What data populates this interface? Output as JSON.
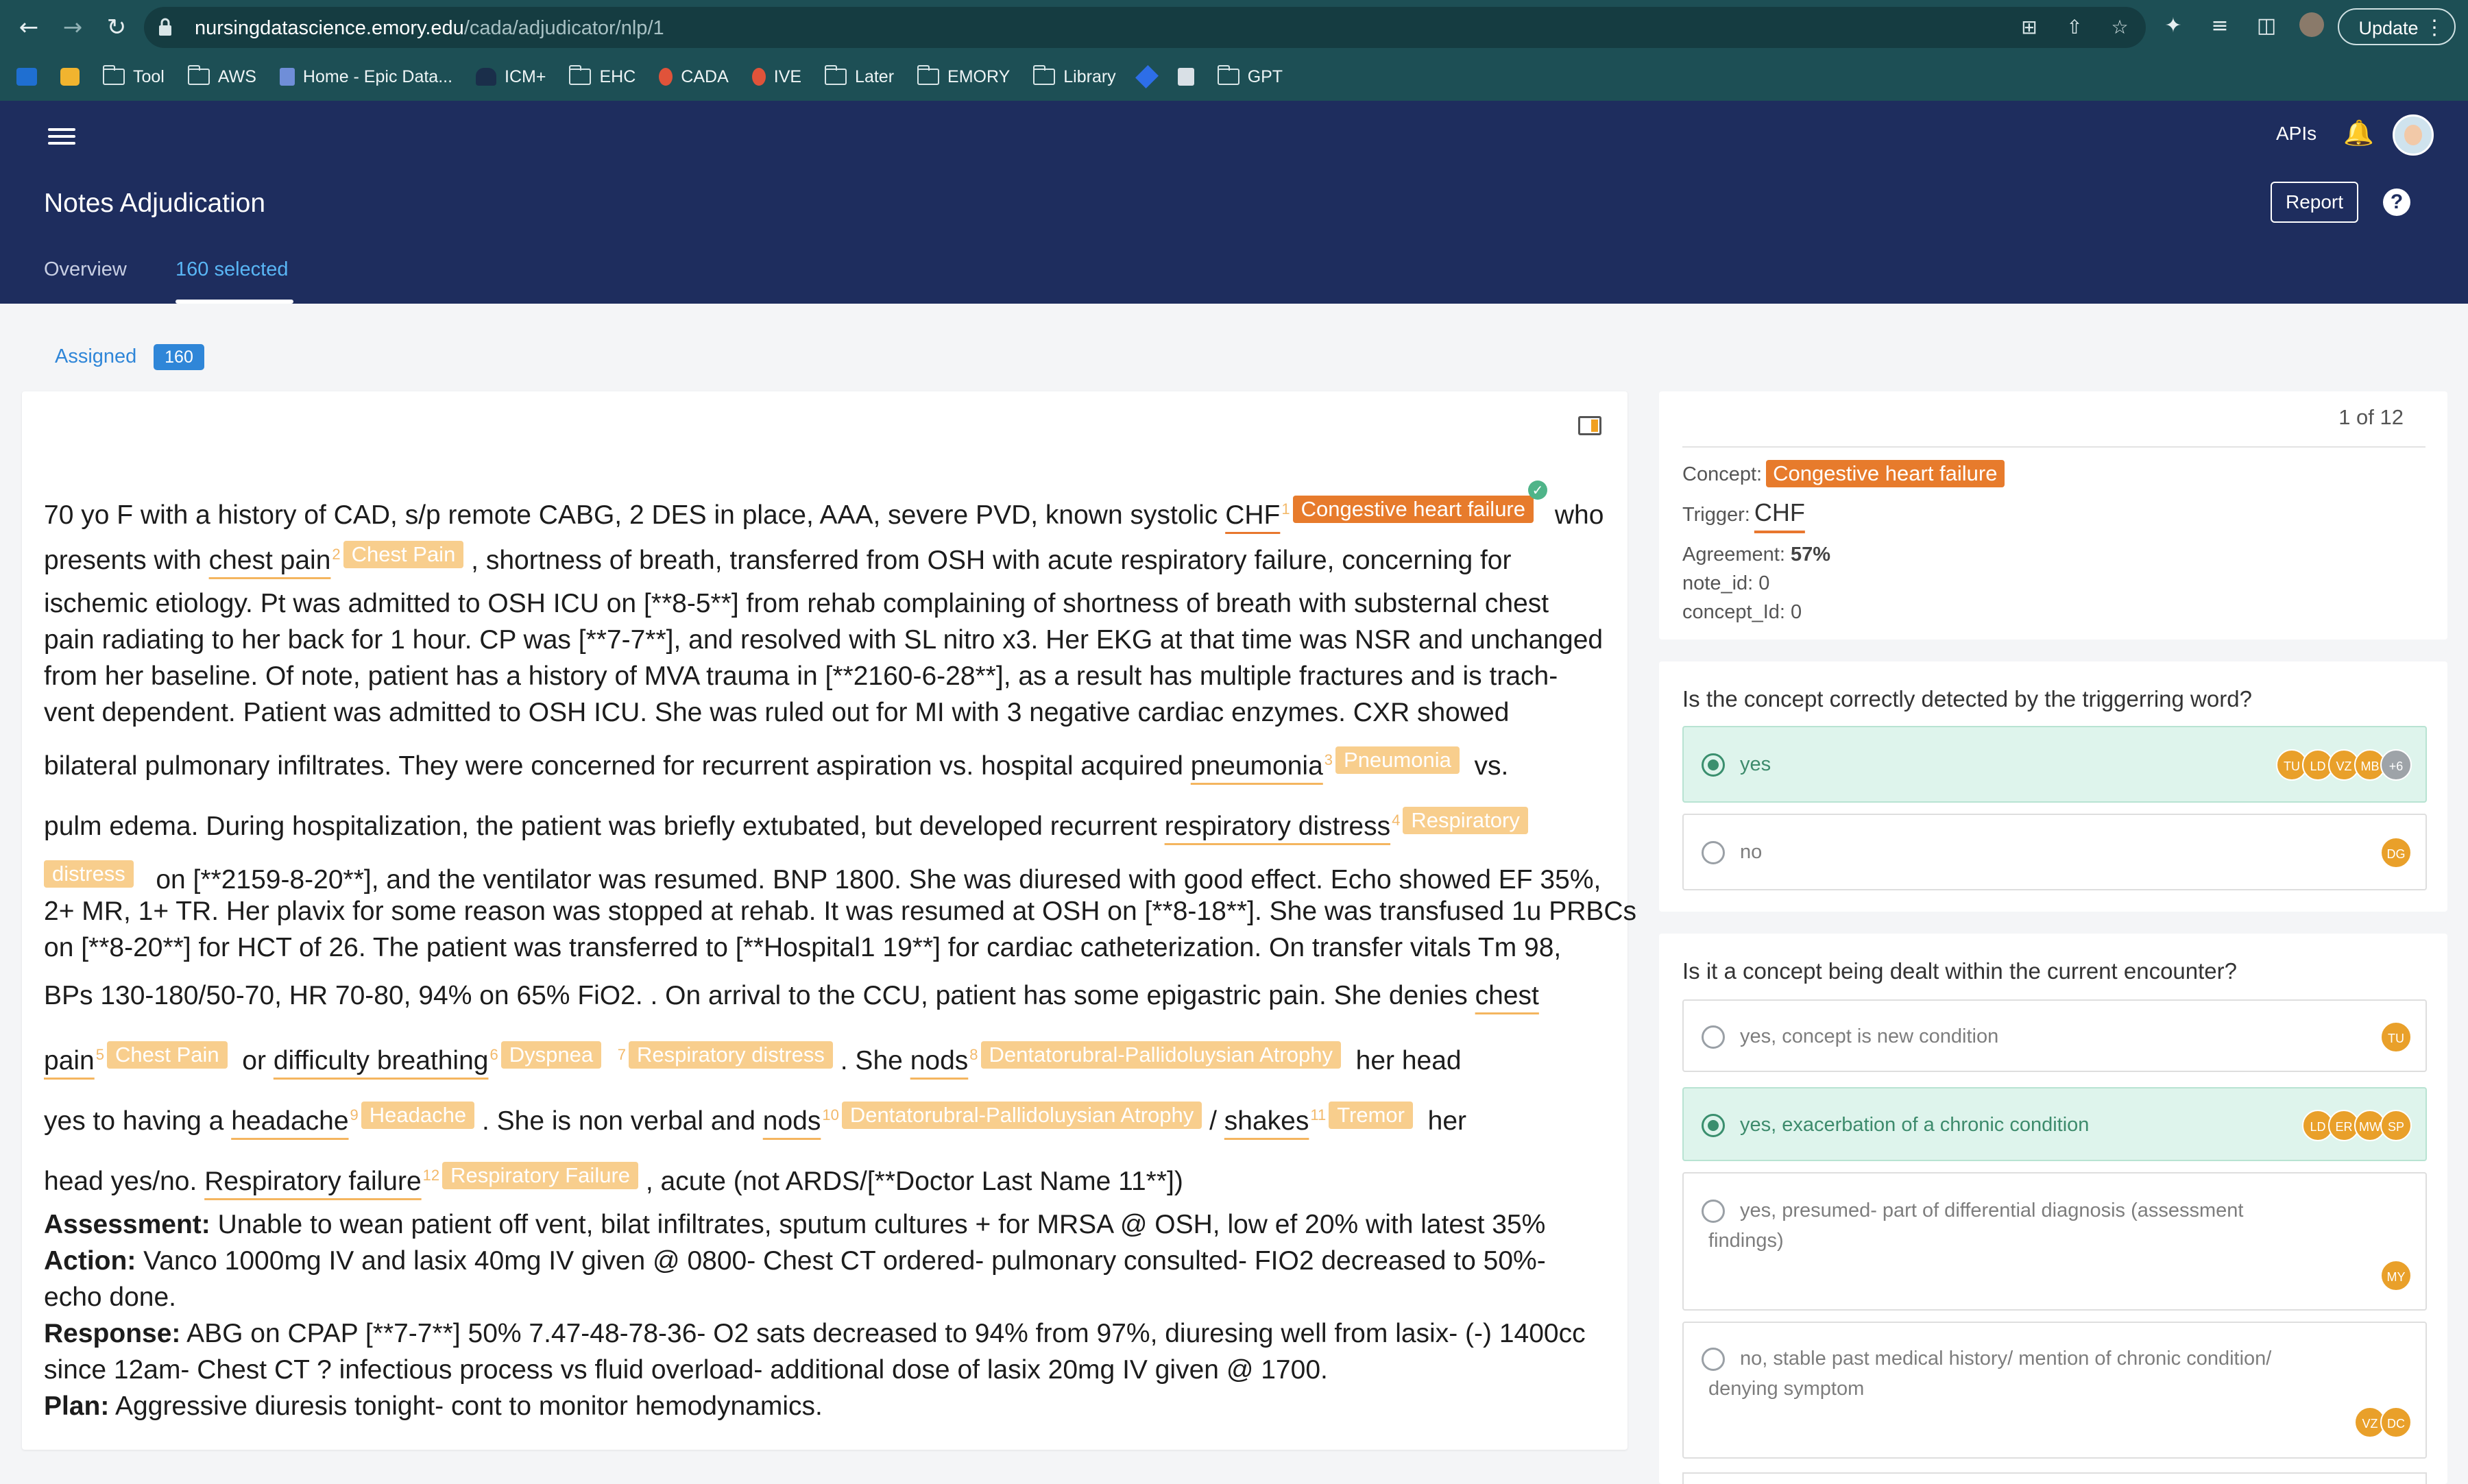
{
  "browser": {
    "url_host": "nursingdatascience.emory.edu",
    "url_path": "/cada/adjudicator/nlp/1",
    "update_label": "Update",
    "bookmarks": [
      "Tool",
      "AWS",
      "Home - Epic Data...",
      "ICM+",
      "EHC",
      "CADA",
      "IVE",
      "Later",
      "EMORY",
      "Library",
      "GPT"
    ]
  },
  "header": {
    "apis": "APIs",
    "title": "Notes Adjudication",
    "report": "Report",
    "help": "?",
    "tabs": [
      "Overview",
      "160 selected"
    ]
  },
  "assigned": {
    "label": "Assigned",
    "count": "160"
  },
  "note": {
    "l1a": "70 yo F with a history of CAD, s/p remote CABG, 2 DES in place, AAA, severe PVD, known systolic",
    "t1": "CHF",
    "n1": "1",
    "g1": "Congestive heart failure",
    "l1b": "who",
    "l2a": "presents with",
    "t2": "chest pain",
    "n2": "2",
    "g2": "Chest Pain",
    "l2b": ", shortness of breath, transferred from OSH with acute respiratory failure, concerning for",
    "l3": "ischemic etiology. Pt was admitted to OSH ICU on [**8-5**] from rehab complaining of shortness of breath with substernal chest",
    "l4": "pain radiating to her back for 1 hour. CP was [**7-7**], and resolved with SL nitro x3. Her EKG at that time was NSR and unchanged",
    "l5": "from her baseline. Of note, patient has a history of MVA trauma in [**2160-6-28**], as a result has multiple fractures and is trach-",
    "l6": "vent dependent. Patient was admitted to OSH ICU. She was ruled out for MI with 3 negative cardiac enzymes. CXR showed",
    "l7a": "bilateral pulmonary infiltrates. They were concerned for recurrent aspiration vs. hospital acquired",
    "t3": "pneumonia",
    "n3": "3",
    "g3": "Pneumonia",
    "l7b": "vs.",
    "l8a": "pulm edema. During hospitalization, the patient was briefly extubated, but developed recurrent",
    "t4": "respiratory distress",
    "n4": "4",
    "g4a": "Respiratory",
    "g4b": "distress",
    "l9": "on [**2159-8-20**], and the ventilator was resumed. BNP 1800. She was diuresed with good effect. Echo showed EF 35%,",
    "l10": "2+ MR, 1+ TR. Her plavix for some reason was stopped at rehab. It was resumed at OSH on [**8-18**]. She was transfused 1u PRBCs",
    "l11": "on [**8-20**] for HCT of 26. The patient was transferred to [**Hospital1 19**] for cardiac catheterization. On transfer vitals Tm 98,",
    "l12a": "BPs 130-180/50-70, HR 70-80, 94% on 65% FiO2. . On arrival to the CCU, patient has some epigastric pain. She denies",
    "t5a": "chest",
    "t5b": "pain",
    "n5": "5",
    "g5": "Chest Pain",
    "or": "or",
    "t6": "difficulty breathing",
    "n6": "6",
    "g6": "Dyspnea",
    "n7": "7",
    "g7": "Respiratory distress",
    "she": ". She",
    "t8": "nods",
    "n8": "8",
    "g8": "Dentatorubral-Pallidoluysian Atrophy",
    "herhead": "her head",
    "l14a": "yes to having a",
    "t9": "headache",
    "n9": "9",
    "g9": "Headache",
    "l14b": ". She is non verbal and",
    "t10": "nods",
    "n10": "10",
    "g10": "Dentatorubral-Pallidoluysian Atrophy",
    "slash": "/",
    "t11": "shakes",
    "n11": "11",
    "g11": "Tremor",
    "her": "her",
    "l15a": "head yes/no.",
    "t12": "Respiratory failure",
    "n12": "12",
    "g12": "Respiratory Failure",
    "l15b": ", acute (not ARDS/[**Doctor Last Name 11**])",
    "assess_h": "Assessment:",
    "assess": "Unable to wean patient off vent, bilat infiltrates, sputum cultures + for MRSA @ OSH, low ef 20% with latest 35%",
    "action_h": "Action:",
    "action": "Vanco 1000mg IV and lasix 40mg IV given @ 0800- Chest CT ordered- pulmonary consulted- FIO2 decreased to 50%-",
    "action2": "echo done.",
    "resp_h": "Response:",
    "resp": "ABG on CPAP [**7-7**] 50% 7.47-48-78-36- O2 sats decreased to 94% from 97%, diuresing well from lasix- (-) 1400cc",
    "resp2": "since 12am- Chest CT ? infectious process vs fluid overload- additional dose of lasix 20mg IV given @ 1700.",
    "plan_h": "Plan:",
    "plan": "Aggressive diuresis tonight- cont to monitor hemodynamics."
  },
  "panel": {
    "counter": "1 of 12",
    "concept_label": "Concept:",
    "concept": "Congestive heart failure",
    "trigger_label": "Trigger:",
    "trigger": "CHF",
    "agreement_label": "Agreement:",
    "agreement": "57%",
    "note_id": "note_id: 0",
    "concept_id": "concept_Id: 0"
  },
  "q1": {
    "title": "Is the concept correctly detected by the triggerring word?",
    "options": [
      {
        "label": "yes",
        "avatars": [
          "TU",
          "LD",
          "VZ",
          "MB",
          "+6"
        ]
      },
      {
        "label": "no",
        "avatars": [
          "DG"
        ]
      }
    ]
  },
  "q2": {
    "title": "Is it a concept being dealt within the current encounter?",
    "options": [
      {
        "label": "yes, concept is new condition",
        "avatars": [
          "TU"
        ]
      },
      {
        "label": "yes, exacerbation of a chronic condition",
        "avatars": [
          "LD",
          "ER",
          "MW",
          "SP"
        ]
      },
      {
        "label": "yes, presumed- part of differential diagnosis (assessment",
        "label2": "findings)",
        "avatars": [
          "MY"
        ]
      },
      {
        "label": "no, stable past medical history/ mention of chronic condition/",
        "label2": "denying symptom",
        "avatars": [
          "VZ",
          "DC"
        ]
      }
    ]
  },
  "colors": {
    "header": "#1e2d5e",
    "accent": "#e77b2c",
    "selected": "#def4ec",
    "link": "#2f86d8"
  },
  "icons": [
    "back-arrow-icon",
    "forward-arrow-icon",
    "reload-icon",
    "lock-icon",
    "install-icon",
    "share-icon",
    "star-icon",
    "extensions-icon",
    "reading-list-icon",
    "side-panel-icon",
    "menu-icon",
    "bell-icon",
    "help-icon",
    "panel-toggle-icon",
    "check-icon"
  ]
}
